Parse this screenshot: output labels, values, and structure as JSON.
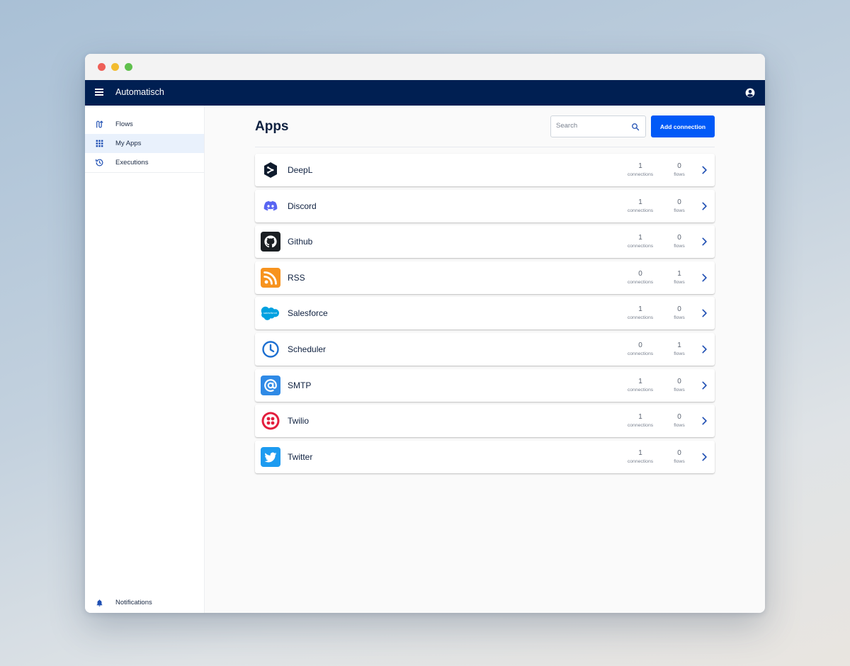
{
  "app_title": "Automatisch",
  "sidebar": {
    "items": [
      {
        "label": "Flows",
        "icon": "flow-icon",
        "active": false
      },
      {
        "label": "My Apps",
        "icon": "apps-grid-icon",
        "active": true
      },
      {
        "label": "Executions",
        "icon": "history-icon",
        "active": false
      }
    ],
    "notifications_label": "Notifications"
  },
  "main": {
    "title": "Apps",
    "search_placeholder": "Search",
    "add_button_label": "Add connection",
    "connections_label": "connections",
    "flows_label": "flows",
    "apps": [
      {
        "name": "DeepL",
        "connections": "1",
        "flows": "0",
        "icon": "deepl-logo"
      },
      {
        "name": "Discord",
        "connections": "1",
        "flows": "0",
        "icon": "discord-logo"
      },
      {
        "name": "Github",
        "connections": "1",
        "flows": "0",
        "icon": "github-logo"
      },
      {
        "name": "RSS",
        "connections": "0",
        "flows": "1",
        "icon": "rss-logo"
      },
      {
        "name": "Salesforce",
        "connections": "1",
        "flows": "0",
        "icon": "salesforce-logo",
        "logo_text": "salesforce"
      },
      {
        "name": "Scheduler",
        "connections": "0",
        "flows": "1",
        "icon": "scheduler-logo"
      },
      {
        "name": "SMTP",
        "connections": "1",
        "flows": "0",
        "icon": "smtp-logo"
      },
      {
        "name": "Twilio",
        "connections": "1",
        "flows": "0",
        "icon": "twilio-logo"
      },
      {
        "name": "Twitter",
        "connections": "1",
        "flows": "0",
        "icon": "twitter-logo"
      }
    ]
  },
  "colors": {
    "appbar": "#001f52",
    "primary": "#0059f7",
    "nav_active_bg": "#e9f1fc"
  }
}
